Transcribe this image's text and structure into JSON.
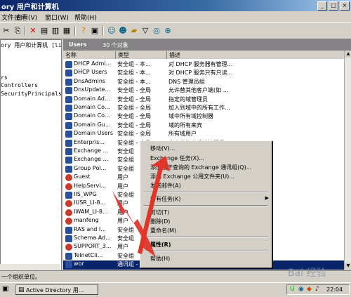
{
  "window": {
    "title": "ory 用户和计算机"
  },
  "menu": [
    "文件(F)",
    "查看(V)",
    "窗口(W)",
    "帮助(H)"
  ],
  "tree": [
    "ory 用户和计算机 [li-",
    "",
    "rs",
    "Controllers",
    "SecurityPrincipals"
  ],
  "pane": {
    "title": "Users",
    "count": "30 个对象"
  },
  "columns": [
    "名称",
    "类型",
    "描述"
  ],
  "rows": [
    {
      "name": "DHCP Admi...",
      "type": "安全组 - 本...",
      "desc": "对 DHCP 服务器有管理...",
      "icon": "group-icon"
    },
    {
      "name": "DHCP Users",
      "type": "安全组 - 本...",
      "desc": "对 DHCP 服务只有只读...",
      "icon": "group-icon"
    },
    {
      "name": "DnsAdmins",
      "type": "安全组 - 本...",
      "desc": "DNS 管理员组",
      "icon": "group-icon"
    },
    {
      "name": "DnsUpdate...",
      "type": "安全组 - 全局",
      "desc": "允许替其他客户端(如 ...",
      "icon": "group-icon"
    },
    {
      "name": "Domain Ad...",
      "type": "安全组 - 全局",
      "desc": "指定的域管理员",
      "icon": "group-icon"
    },
    {
      "name": "Domain Co...",
      "type": "安全组 - 全局",
      "desc": "加入到域中的所有工作...",
      "icon": "group-icon"
    },
    {
      "name": "Domain Co...",
      "type": "安全组 - 全局",
      "desc": "域中所有域控制器",
      "icon": "group-icon"
    },
    {
      "name": "Domain Gu...",
      "type": "安全组 - 全局",
      "desc": "域的所有来宾",
      "icon": "group-icon"
    },
    {
      "name": "Domain Users",
      "type": "安全组 - 全局",
      "desc": "所有域用户",
      "icon": "group-icon"
    },
    {
      "name": "Enterpris...",
      "type": "安全组 - 全局",
      "desc": "企业的指定系统管理员",
      "icon": "group-icon"
    },
    {
      "name": "Exchange ...",
      "type": "安全组",
      "desc": "",
      "icon": "group-icon"
    },
    {
      "name": "Exchange ...",
      "type": "安全组",
      "desc": "",
      "icon": "group-icon"
    },
    {
      "name": "Group Pol...",
      "type": "安全组",
      "desc": "",
      "icon": "group-icon"
    },
    {
      "name": "Guest",
      "type": "用户",
      "desc": "",
      "icon": "user-icon"
    },
    {
      "name": "HelpServi...",
      "type": "用户",
      "desc": "",
      "icon": "user-icon"
    },
    {
      "name": "IIS_WPG",
      "type": "安全组",
      "desc": "",
      "icon": "group-icon"
    },
    {
      "name": "IUSR_LI-8...",
      "type": "用户",
      "desc": "",
      "icon": "user-icon"
    },
    {
      "name": "IWAM_LI-8...",
      "type": "用户",
      "desc": "",
      "icon": "user-icon"
    },
    {
      "name": "manfeng",
      "type": "用户",
      "desc": "",
      "icon": "user-icon"
    },
    {
      "name": "RAS and I...",
      "type": "安全组",
      "desc": "",
      "icon": "group-icon"
    },
    {
      "name": "Schema Ad...",
      "type": "安全组",
      "desc": "",
      "icon": "group-icon"
    },
    {
      "name": "SUPPORT_3...",
      "type": "用户",
      "desc": "",
      "icon": "user-icon"
    },
    {
      "name": "TelnetCli...",
      "type": "安全组",
      "desc": "",
      "icon": "group-icon"
    },
    {
      "name": "wor",
      "type": "通讯组 - 全局",
      "desc": "",
      "icon": "group-icon",
      "selected": true
    }
  ],
  "context_menu": {
    "move": "移动(V)...",
    "exchange_tasks": "Exchange 任务(X)...",
    "add_query_group": "添加基于查询的 Exchange 通讯组(Q)...",
    "add_public_folder": "添加 Exchange 公用文件夹(U)...",
    "send_mail": "发送邮件(A)",
    "all_tasks": "所有任务(K)",
    "cut": "剪切(T)",
    "delete": "删除(D)",
    "rename": "重命名(M)",
    "properties": "属性(R)",
    "help": "帮助(H)"
  },
  "status": "一个组织单位。",
  "taskbar": {
    "app": "Active Directory 用...",
    "clock": "22:04"
  },
  "watermark": "Bai 经验",
  "colors": {
    "title_start": "#0a246a",
    "selection": "#0a246a",
    "arrow": "#e0352b",
    "header": "#848284"
  }
}
